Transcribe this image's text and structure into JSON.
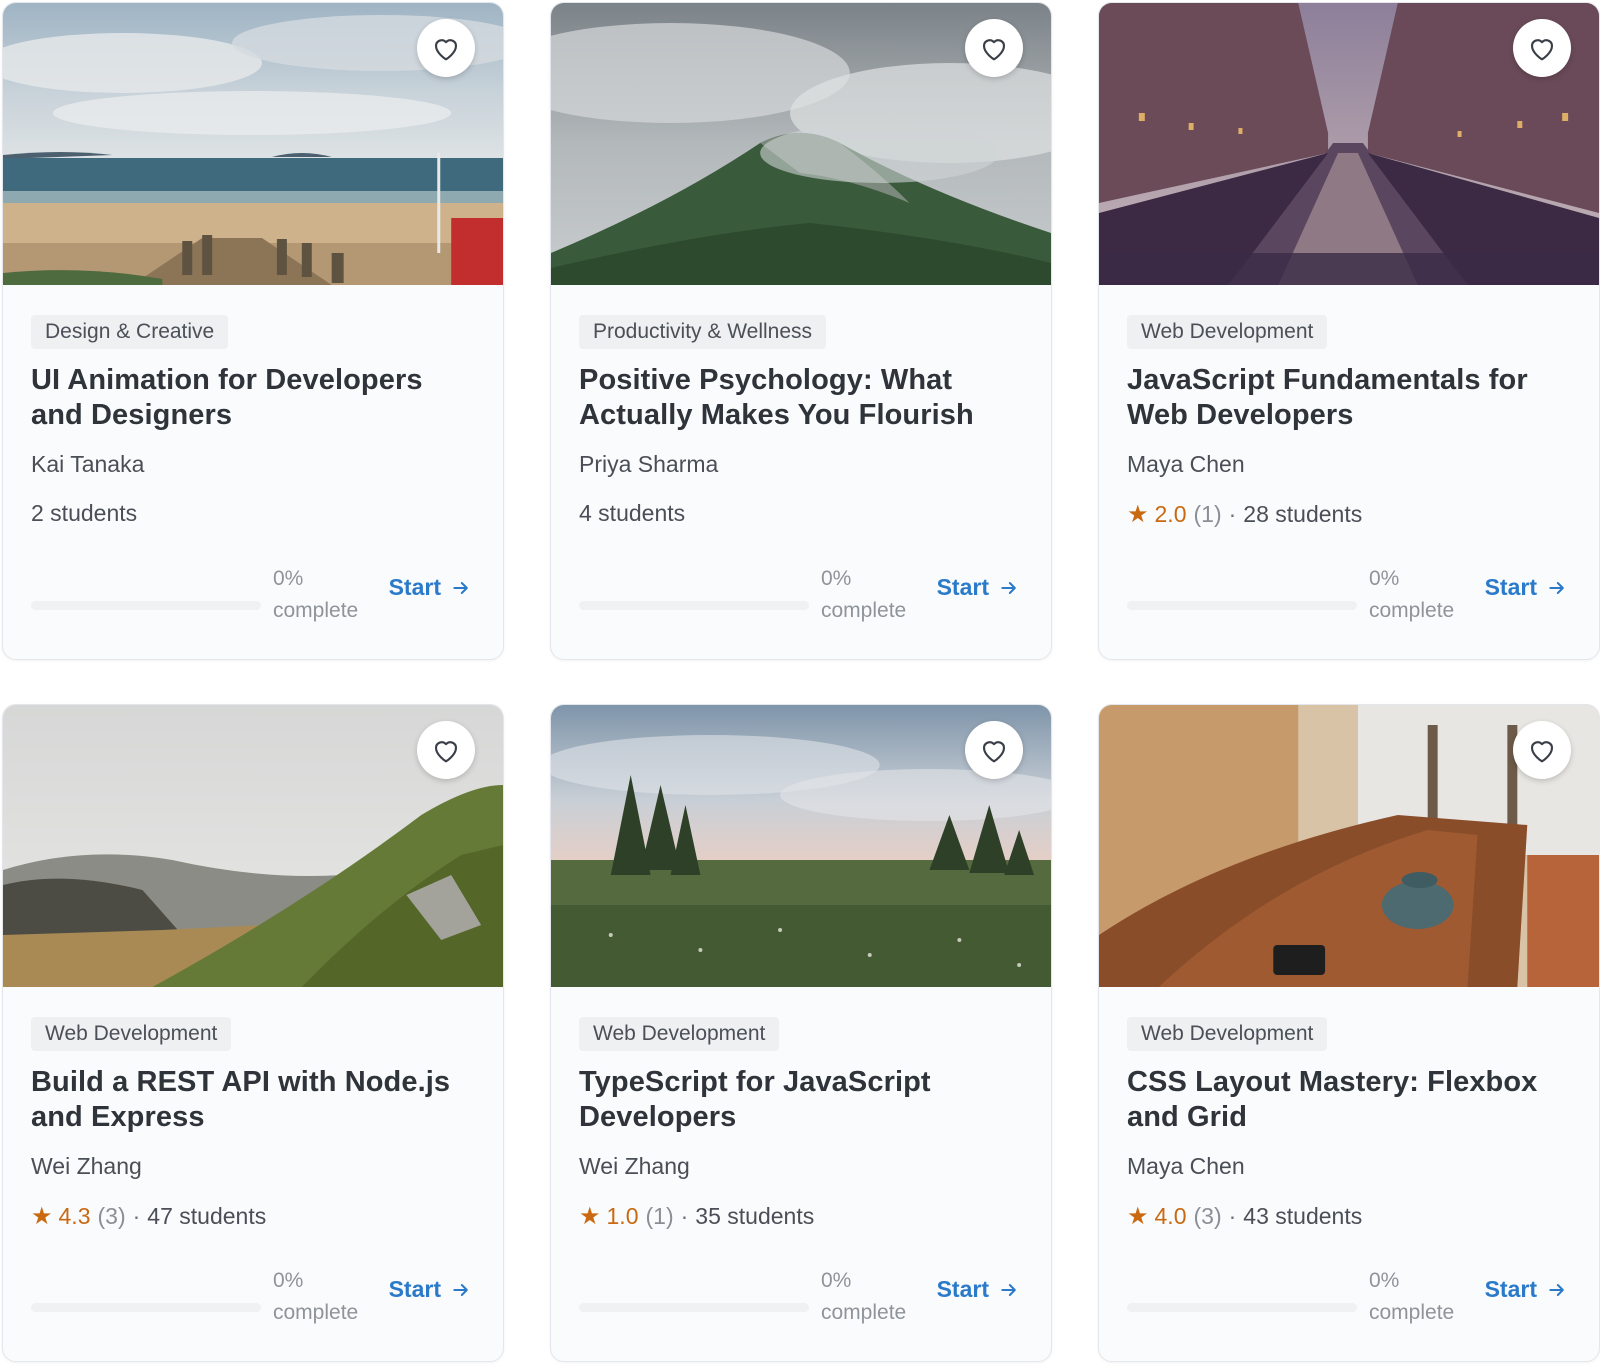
{
  "theme": {
    "accent": "#2a7ac9",
    "star_color": "#c96a12"
  },
  "courses": [
    {
      "image": "beach-with-boardwalk-image",
      "category": "Design & Creative",
      "title": "UI Animation for Developers and Designers",
      "instructor": "Kai Tanaka",
      "rating": null,
      "rating_count": null,
      "students": "2 students",
      "progress_value": 0,
      "progress_pct": "0%",
      "progress_label": "complete",
      "action": "Start"
    },
    {
      "image": "misty-mountain-image",
      "category": "Productivity & Wellness",
      "title": "Positive Psychology: What Actually Makes You Flourish",
      "instructor": "Priya Sharma",
      "rating": null,
      "rating_count": null,
      "students": "4 students",
      "progress_value": 0,
      "progress_pct": "0%",
      "progress_label": "complete",
      "action": "Start"
    },
    {
      "image": "city-canal-image",
      "category": "Web Development",
      "title": "JavaScript Fundamentals for Web Developers",
      "instructor": "Maya Chen",
      "rating": "2.0",
      "rating_count": "(1)",
      "students": "28 students",
      "progress_value": 0,
      "progress_pct": "0%",
      "progress_label": "complete",
      "action": "Start"
    },
    {
      "image": "hillside-trail-image",
      "category": "Web Development",
      "title": "Build a REST API with Node.js and Express",
      "instructor": "Wei Zhang",
      "rating": "4.3",
      "rating_count": "(3)",
      "students": "47 students",
      "progress_value": 0,
      "progress_pct": "0%",
      "progress_label": "complete",
      "action": "Start"
    },
    {
      "image": "meadow-with-trees-image",
      "category": "Web Development",
      "title": "TypeScript for JavaScript Developers",
      "instructor": "Wei Zhang",
      "rating": "1.0",
      "rating_count": "(1)",
      "students": "35 students",
      "progress_value": 0,
      "progress_pct": "0%",
      "progress_label": "complete",
      "action": "Start"
    },
    {
      "image": "cafe-table-with-coffee-image",
      "category": "Web Development",
      "title": "CSS Layout Mastery: Flexbox and Grid",
      "instructor": "Maya Chen",
      "rating": "4.0",
      "rating_count": "(3)",
      "students": "43 students",
      "progress_value": 0,
      "progress_pct": "0%",
      "progress_label": "complete",
      "action": "Start"
    }
  ]
}
